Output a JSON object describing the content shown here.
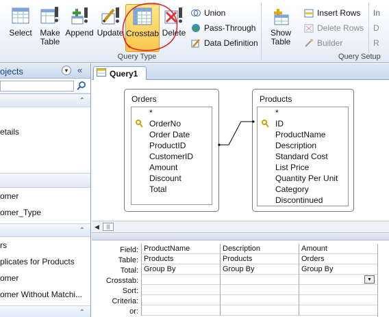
{
  "ribbon": {
    "query_type_buttons": [
      {
        "name": "select",
        "label": "Select"
      },
      {
        "name": "make-table",
        "label": "Make\nTable"
      },
      {
        "name": "append",
        "label": "Append"
      },
      {
        "name": "update",
        "label": "Update"
      },
      {
        "name": "crosstab",
        "label": "Crosstab"
      },
      {
        "name": "delete",
        "label": "Delete"
      }
    ],
    "query_type_small": [
      {
        "name": "union",
        "label": "Union"
      },
      {
        "name": "pass-through",
        "label": "Pass-Through"
      },
      {
        "name": "data-definition",
        "label": "Data Definition"
      }
    ],
    "query_type_group_label": "Query Type",
    "show_table_label": "Show\nTable",
    "setup_small": [
      {
        "name": "insert-rows",
        "label": "Insert Rows",
        "enabled": true
      },
      {
        "name": "delete-rows",
        "label": "Delete Rows",
        "enabled": false
      },
      {
        "name": "builder",
        "label": "Builder",
        "enabled": false
      }
    ],
    "query_setup_group_label": "Query Setup",
    "cut_off_labels": [
      "In",
      "D",
      "R"
    ]
  },
  "nav": {
    "header_title": "ojects",
    "items_group1": [
      "",
      "etails",
      "",
      ""
    ],
    "items_group2": [
      "omer",
      "omer_Type"
    ],
    "items_group3": [
      "rs",
      "plicates for Products",
      "omer",
      "omer Without Matchi..."
    ]
  },
  "document": {
    "tab_label": "Query1",
    "tables": [
      {
        "name": "Orders",
        "fields": [
          "*",
          "OrderNo",
          "Order Date",
          "ProductID",
          "CustomerID",
          "Amount",
          "Discount",
          "Total"
        ],
        "key_field_index": 1
      },
      {
        "name": "Products",
        "fields": [
          "*",
          "ID",
          "ProductName",
          "Description",
          "Standard Cost",
          "List Price",
          "Quantity Per Unit",
          "Category",
          "Discontinued"
        ],
        "key_field_index": 1
      }
    ],
    "grid": {
      "row_labels": [
        "Field:",
        "Table:",
        "Total:",
        "Crosstab:",
        "Sort:",
        "Criteria:",
        "or:"
      ],
      "columns": [
        {
          "field": "ProductName",
          "table": "Products",
          "total": "Group By"
        },
        {
          "field": "Description",
          "table": "Products",
          "total": "Group By"
        },
        {
          "field": "Amount",
          "table": "Orders",
          "total": "Group By"
        }
      ]
    }
  },
  "colors": {
    "accent": "#15428b",
    "highlight": "#fcc64c",
    "annotation": "#e11d1d"
  }
}
